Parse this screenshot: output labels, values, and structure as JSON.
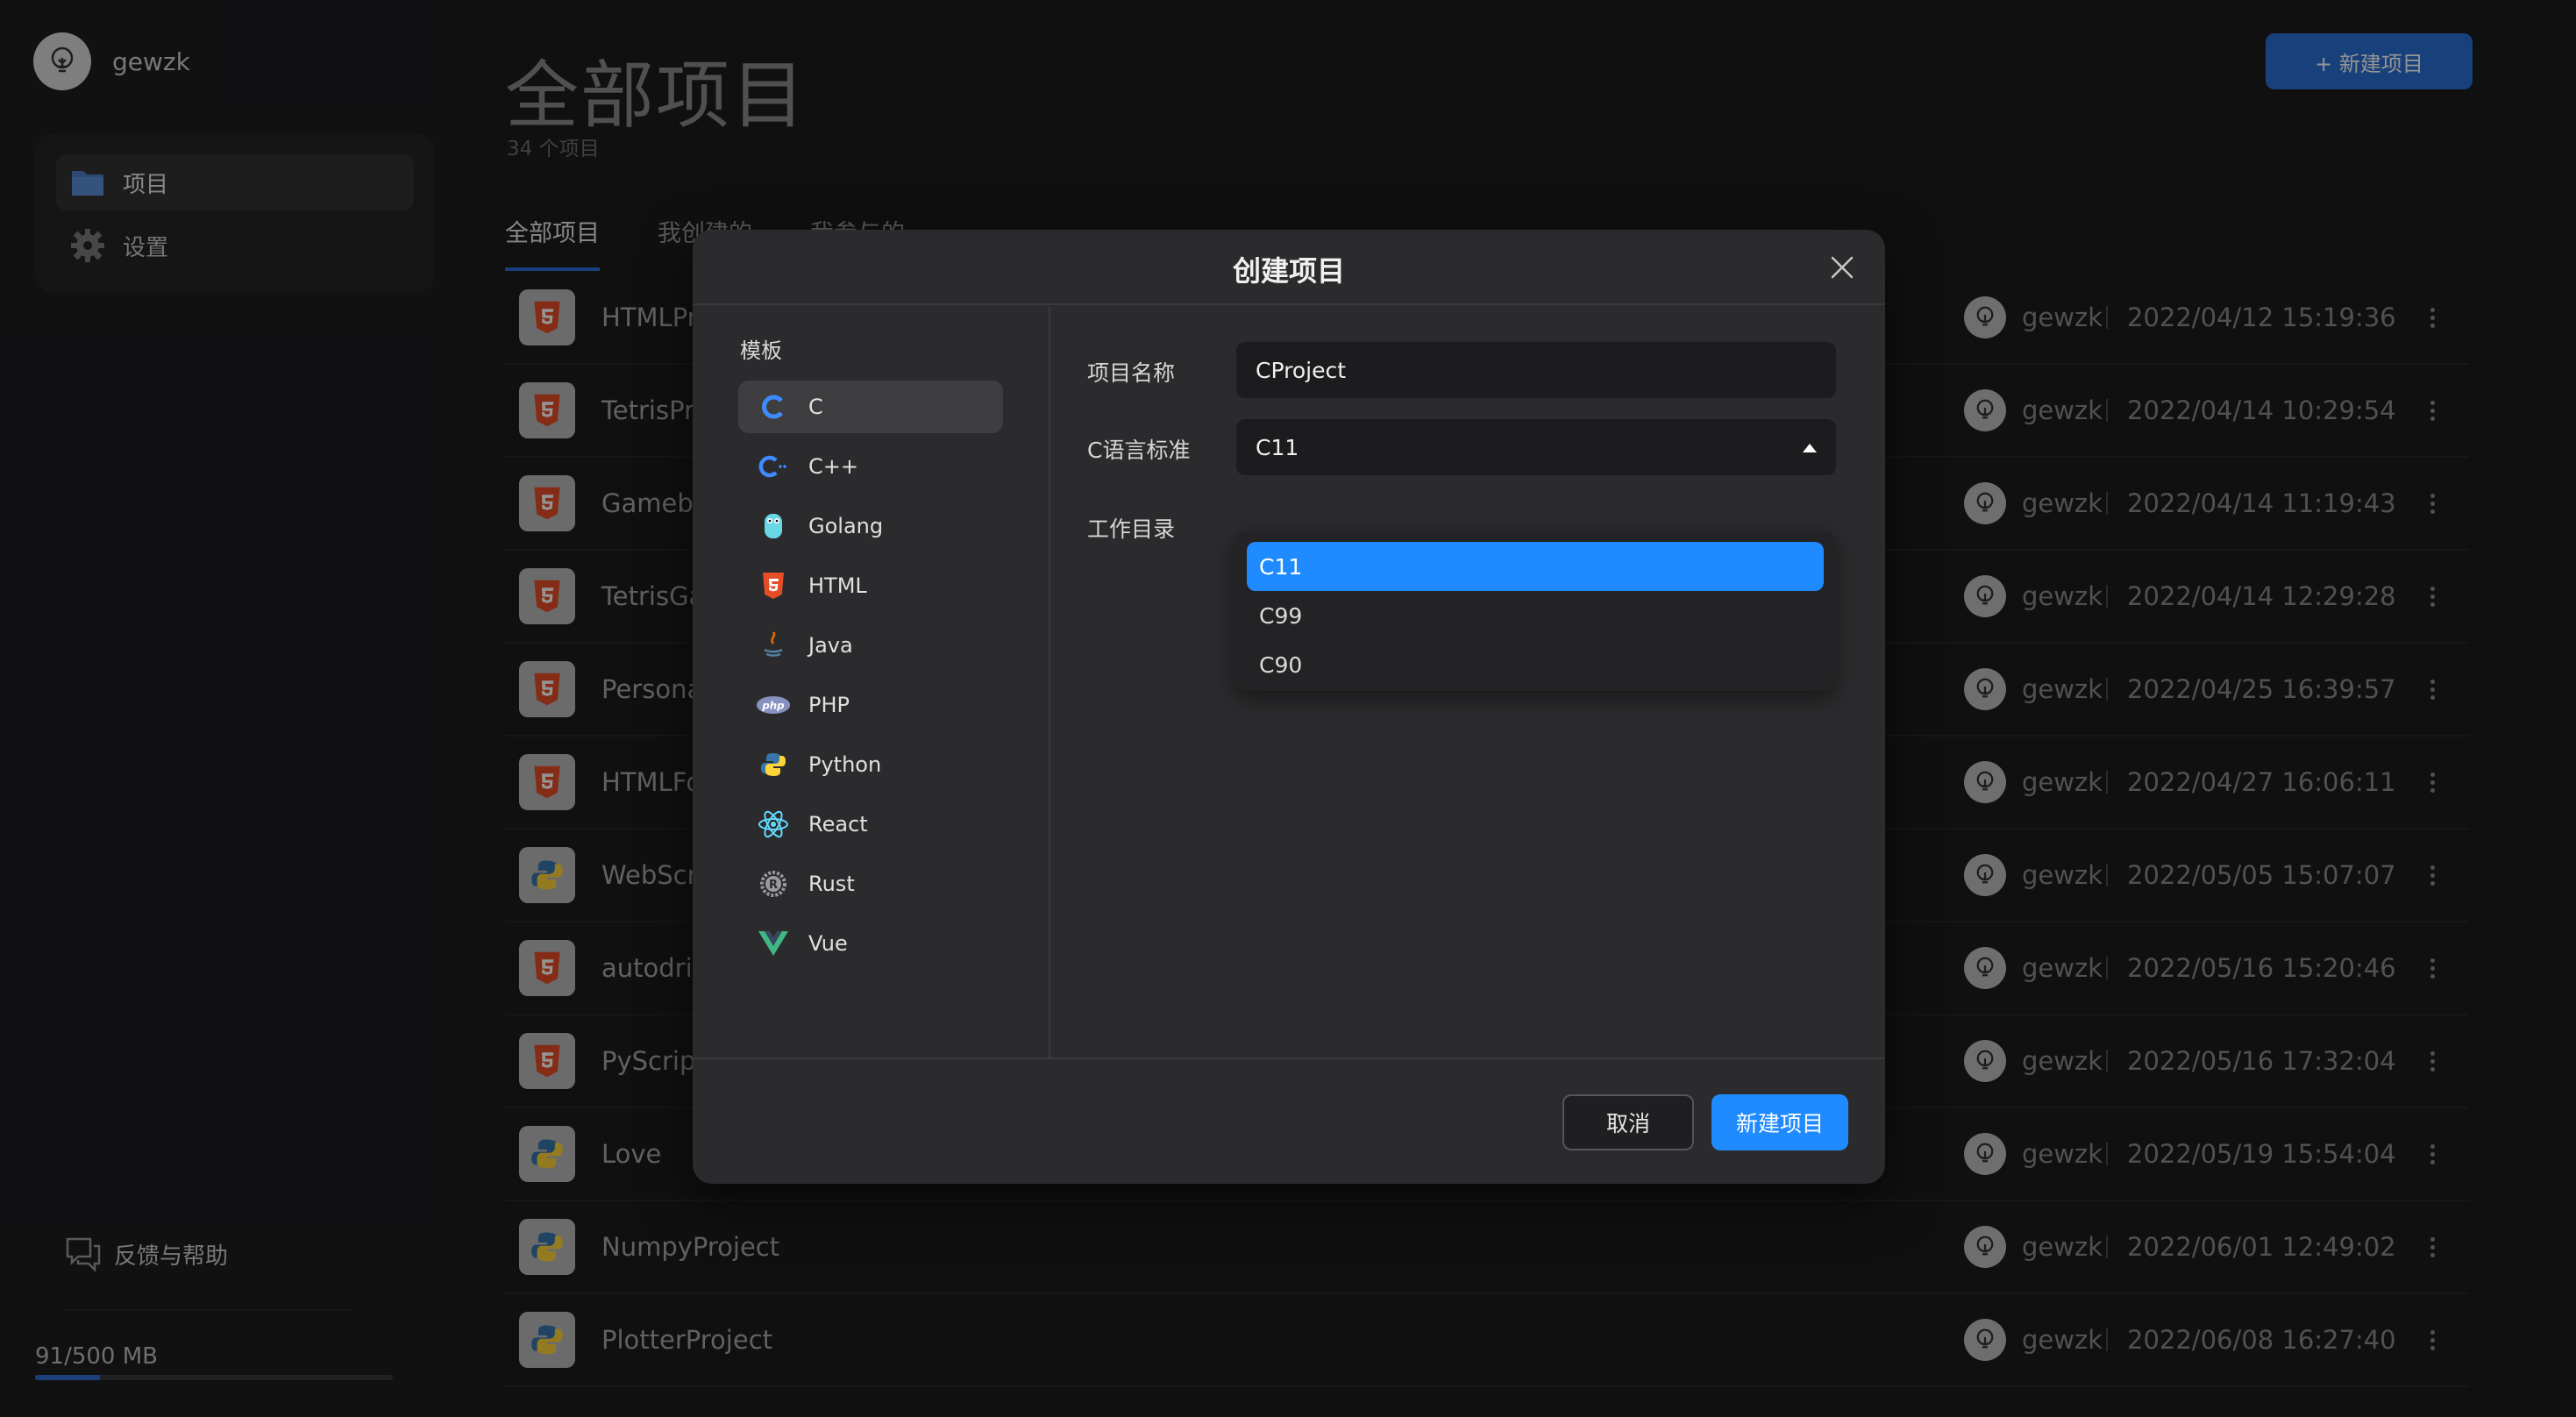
{
  "sidebar": {
    "user_name": "gewzk",
    "nav": [
      {
        "label": "项目",
        "icon": "folder-icon"
      },
      {
        "label": "设置",
        "icon": "gear-icon"
      }
    ],
    "feedback_label": "反馈与帮助",
    "storage_text": "91/500 MB",
    "storage_used_fraction": 0.182
  },
  "header": {
    "title": "全部项目",
    "count": "34 个项目",
    "new_button": "+ 新建项目",
    "tabs": [
      "全部项目",
      "我创建的",
      "我参与的"
    ]
  },
  "projects": [
    {
      "name": "HTMLPro",
      "lang": "html",
      "owner": "gewzk",
      "date": "2022/04/12 15:19:36"
    },
    {
      "name": "TetrisPro",
      "lang": "html",
      "owner": "gewzk",
      "date": "2022/04/14 10:29:54"
    },
    {
      "name": "Gameboy",
      "lang": "html",
      "owner": "gewzk",
      "date": "2022/04/14 11:19:43"
    },
    {
      "name": "TetrisGar",
      "lang": "html",
      "owner": "gewzk",
      "date": "2022/04/14 12:29:28"
    },
    {
      "name": "Personal\\",
      "lang": "html",
      "owner": "gewzk",
      "date": "2022/04/25 16:39:57"
    },
    {
      "name": "HTMLFor",
      "lang": "html",
      "owner": "gewzk",
      "date": "2022/04/27 16:06:11"
    },
    {
      "name": "WebScra",
      "lang": "python",
      "owner": "gewzk",
      "date": "2022/05/05 15:07:07"
    },
    {
      "name": "autodrive",
      "lang": "html",
      "owner": "gewzk",
      "date": "2022/05/16 15:20:46"
    },
    {
      "name": "PyScript",
      "lang": "html",
      "owner": "gewzk",
      "date": "2022/05/16 17:32:04"
    },
    {
      "name": "Love",
      "lang": "python",
      "owner": "gewzk",
      "date": "2022/05/19 15:54:04"
    },
    {
      "name": "NumpyProject",
      "lang": "python",
      "owner": "gewzk",
      "date": "2022/06/01 12:49:02"
    },
    {
      "name": "PlotterProject",
      "lang": "python",
      "owner": "gewzk",
      "date": "2022/06/08 16:27:40"
    }
  ],
  "modal": {
    "title": "创建项目",
    "template_heading": "模板",
    "templates": [
      "C",
      "C++",
      "Golang",
      "HTML",
      "Java",
      "PHP",
      "Python",
      "React",
      "Rust",
      "Vue"
    ],
    "selected_template": "C",
    "labels": {
      "name": "项目名称",
      "standard": "C语言标准",
      "workdir": "工作目录"
    },
    "name_value": "CProject",
    "standard_value": "C11",
    "standard_options": [
      "C11",
      "C99",
      "C90"
    ],
    "cancel": "取消",
    "create": "新建项目"
  },
  "colors": {
    "accent": "#1f8bff",
    "primary_button": "#2a6fd4",
    "html_badge": "#e44d26"
  }
}
